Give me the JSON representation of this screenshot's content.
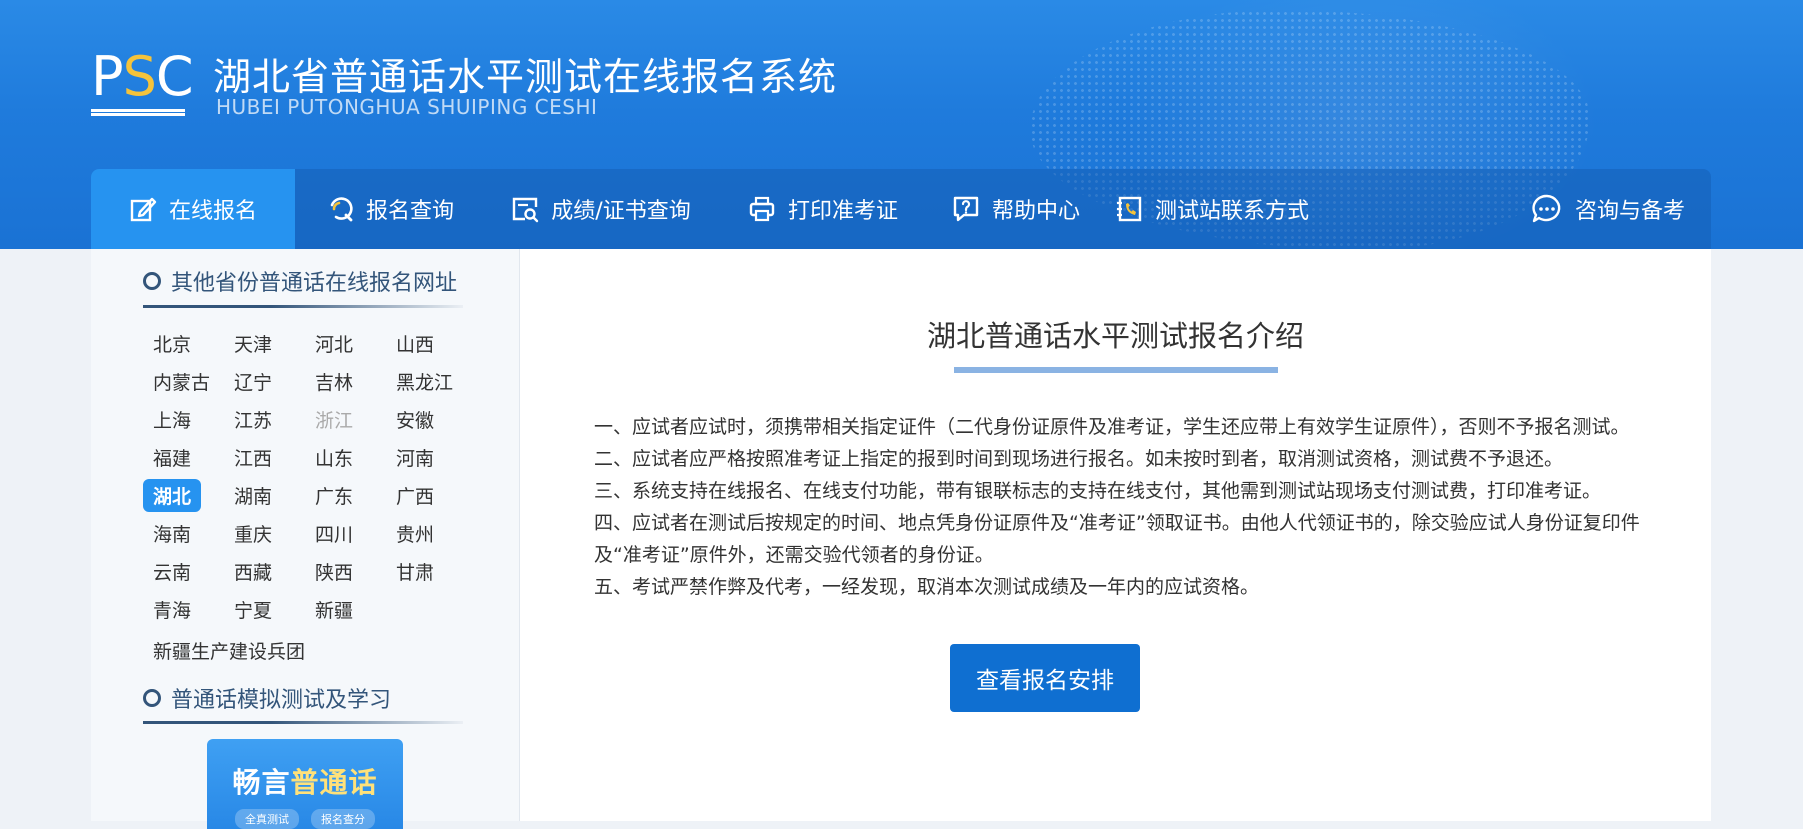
{
  "header": {
    "logo_text": "PSC",
    "title": "湖北省普通话水平测试在线报名系统",
    "subtitle": "HUBEI PUTONGHUA SHUIPING CESHI"
  },
  "nav": {
    "items": [
      {
        "label": "在线报名",
        "icon": "edit-icon",
        "active": true
      },
      {
        "label": "报名查询",
        "icon": "search-icon"
      },
      {
        "label": "成绩/证书查询",
        "icon": "certificate-search-icon"
      },
      {
        "label": "打印准考证",
        "icon": "printer-icon"
      },
      {
        "label": "帮助中心",
        "icon": "help-icon"
      },
      {
        "label": "测试站联系方式",
        "icon": "phone-book-icon"
      }
    ],
    "consult": {
      "label": "咨询与备考",
      "icon": "chat-bubble-icon"
    }
  },
  "sidebar": {
    "provinces_title": "其他省份普通话在线报名网址",
    "provinces": [
      "北京",
      "天津",
      "河北",
      "山西",
      "内蒙古",
      "辽宁",
      "吉林",
      "黑龙江",
      "上海",
      "江苏",
      "浙江",
      "安徽",
      "福建",
      "江西",
      "山东",
      "河南",
      "湖北",
      "湖南",
      "广东",
      "广西",
      "海南",
      "重庆",
      "四川",
      "贵州",
      "云南",
      "西藏",
      "陕西",
      "甘肃",
      "青海",
      "宁夏",
      "新疆"
    ],
    "active_province": "湖北",
    "disabled_province": "浙江",
    "bingtuan": "新疆生产建设兵团",
    "practice_title": "普通话模拟测试及学习",
    "promo": {
      "title_prefix": "畅言",
      "title_highlight": "普通话",
      "tag1": "全真测试",
      "tag2": "报名查分"
    }
  },
  "main": {
    "title": "湖北普通话水平测试报名介绍",
    "paragraphs": [
      "一、应试者应试时，须携带相关指定证件（二代身份证原件及准考证，学生还应带上有效学生证原件），否则不予报名测试。",
      "二、应试者应严格按照准考证上指定的报到时间到现场进行报名。如未按时到者，取消测试资格，测试费不予退还。",
      "三、系统支持在线报名、在线支付功能，带有银联标志的支持在线支付，其他需到测试站现场支付测试费，打印准考证。",
      "四、应试者在测试后按规定的时间、地点凭身份证原件及“准考证”领取证书。由他人代领证书的，除交验应试人身份证复印件及“准考证”原件外，还需交验代领者的身份证。",
      "五、考试严禁作弊及代考，一经发现，取消本次测试成绩及一年内的应试资格。"
    ],
    "cta_label": "查看报名安排"
  },
  "colors": {
    "header_blue": "#1f7bdc",
    "active_nav": "#2693f0",
    "cta_blue": "#0f6fd1",
    "logo_accent": "#f5c33b"
  }
}
